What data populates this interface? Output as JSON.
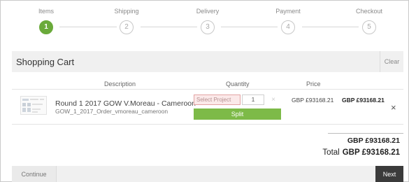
{
  "stepper": {
    "steps": [
      {
        "label": "Items",
        "number": "1",
        "active": true
      },
      {
        "label": "Shipping",
        "number": "2",
        "active": false
      },
      {
        "label": "Delivery",
        "number": "3",
        "active": false
      },
      {
        "label": "Payment",
        "number": "4",
        "active": false
      },
      {
        "label": "Checkout",
        "number": "5",
        "active": false
      }
    ],
    "active_color": "#6aaa3a"
  },
  "cart": {
    "title": "Shopping Cart",
    "clear_label": "Clear",
    "columns": {
      "description": "Description",
      "quantity": "Quantity",
      "price": "Price"
    },
    "items": [
      {
        "title": "Round 1 2017 GOW V.Moreau - Cameroon",
        "subtitle": "GOW_1_2017_Order_vmoreau_cameroon",
        "select_placeholder": "Select Project",
        "quantity": "1",
        "split_label": "Split",
        "price": "GBP £93168.21",
        "line_total": "GBP £93168.21",
        "remove_icon": "close-icon"
      }
    ],
    "subtotal": "GBP £93168.21",
    "total_label": "Total",
    "total": "GBP £93168.21"
  },
  "footer": {
    "continue_label": "Continue",
    "next_label": "Next"
  },
  "colors": {
    "split_button": "#7dba48",
    "next_button": "#3b3b3b",
    "select_error_bg": "#fbe9e9"
  }
}
